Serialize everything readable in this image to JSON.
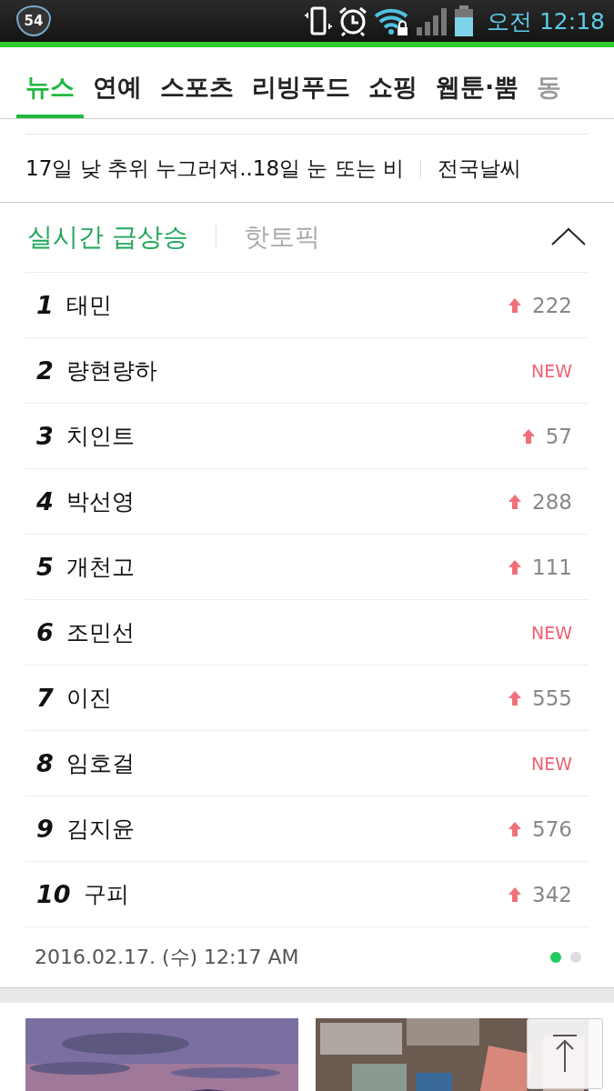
{
  "status_bar": {
    "badge": "54",
    "time": "오전 12:18"
  },
  "tabs": [
    {
      "label": "뉴스",
      "selected": true
    },
    {
      "label": "연예",
      "selected": false
    },
    {
      "label": "스포츠",
      "selected": false
    },
    {
      "label": "리빙푸드",
      "selected": false
    },
    {
      "label": "쇼핑",
      "selected": false
    },
    {
      "label": "웹툰·뿜",
      "selected": false
    },
    {
      "label": "동",
      "selected": false
    }
  ],
  "headline": {
    "text": "17일 낮 추위 누그러져..18일 눈 또는 비",
    "link": "전국날씨"
  },
  "trending": {
    "tabs": [
      {
        "label": "실시간 급상승",
        "selected": true
      },
      {
        "label": "핫토픽",
        "selected": false
      }
    ],
    "expanded": true,
    "rows": [
      {
        "rank": "1",
        "name": "태민",
        "kind": "up",
        "change": "222"
      },
      {
        "rank": "2",
        "name": "량현량하",
        "kind": "new",
        "change": "NEW"
      },
      {
        "rank": "3",
        "name": "치인트",
        "kind": "up",
        "change": "57"
      },
      {
        "rank": "4",
        "name": "박선영",
        "kind": "up",
        "change": "288"
      },
      {
        "rank": "5",
        "name": "개천고",
        "kind": "up",
        "change": "111"
      },
      {
        "rank": "6",
        "name": "조민선",
        "kind": "new",
        "change": "NEW"
      },
      {
        "rank": "7",
        "name": "이진",
        "kind": "up",
        "change": "555"
      },
      {
        "rank": "8",
        "name": "임호걸",
        "kind": "new",
        "change": "NEW"
      },
      {
        "rank": "9",
        "name": "김지윤",
        "kind": "up",
        "change": "576"
      },
      {
        "rank": "10",
        "name": "구피",
        "kind": "up",
        "change": "342"
      }
    ],
    "timestamp": "2016.02.17. (수) 12:17 AM",
    "pages": [
      {
        "selected": true
      },
      {
        "selected": false
      }
    ]
  }
}
